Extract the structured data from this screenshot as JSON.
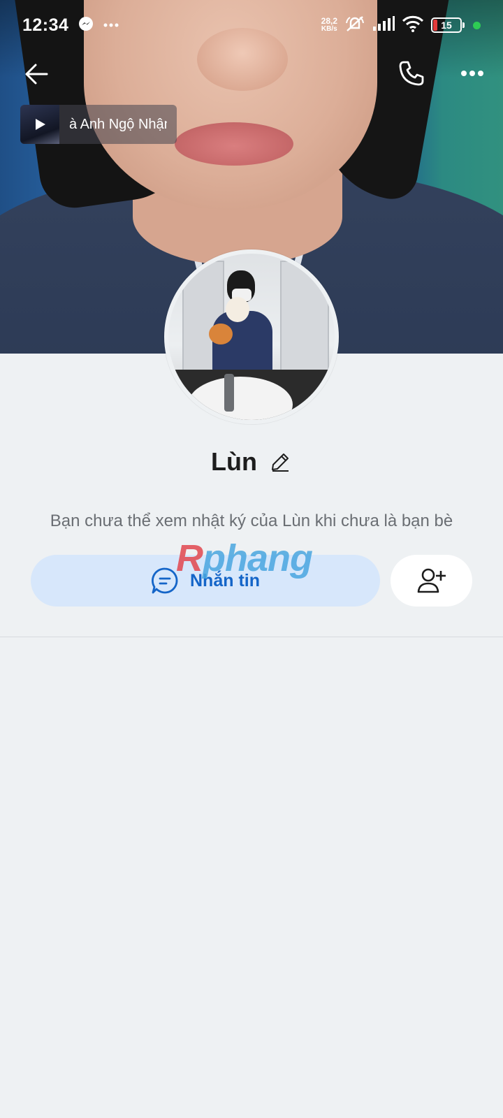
{
  "status_bar": {
    "time": "12:34",
    "network_speed_value": "28,2",
    "network_speed_unit": "KB/s",
    "battery_level": "15",
    "icons": [
      "messenger-icon",
      "more-notifications-icon",
      "mute-icon",
      "signal-icon",
      "wifi-icon",
      "battery-icon",
      "active-dot"
    ]
  },
  "top_nav": {
    "icons": [
      "back-arrow-icon",
      "phone-icon",
      "more-icon"
    ]
  },
  "music": {
    "title": "à Anh Ngộ Nhận"
  },
  "profile": {
    "name": "Lùn",
    "diary_notice": "Bạn chưa thể xem nhật ký của Lùn khi chưa là bạn bè"
  },
  "actions": {
    "message_label": "Nhắn tin",
    "accent_color": "#1465c8",
    "message_bg": "#d7e7fb"
  },
  "watermark": {
    "part_a": "R",
    "part_b": "phang"
  }
}
